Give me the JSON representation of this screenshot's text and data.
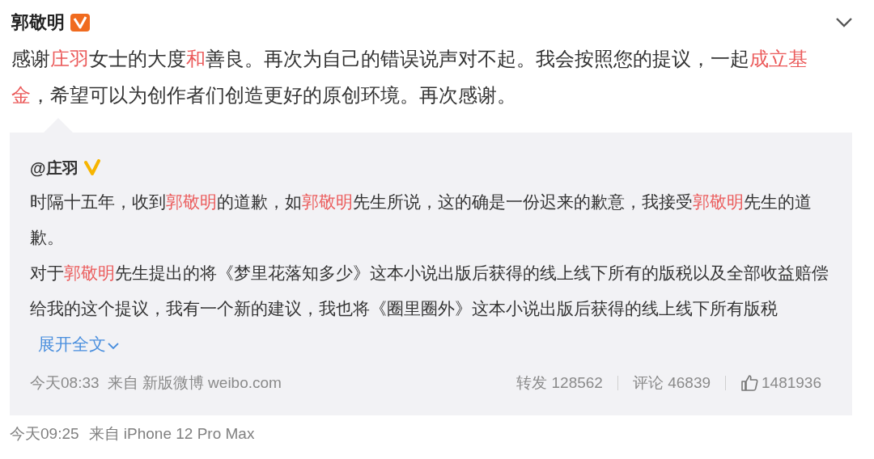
{
  "author": {
    "name": "郭敬明",
    "verified": true
  },
  "post": {
    "segments": [
      {
        "text": "感谢",
        "highlight": false
      },
      {
        "text": "庄羽",
        "highlight": true
      },
      {
        "text": "女士的大度",
        "highlight": false
      },
      {
        "text": "和",
        "highlight": true
      },
      {
        "text": "善良。再次为自己的错误说声对不起。我会按照您的提议，一起",
        "highlight": false
      },
      {
        "text": "成立基金",
        "highlight": true
      },
      {
        "text": "，希望可以为创作者们创造更好的原创环境。再次感谢。",
        "highlight": false
      }
    ]
  },
  "quote": {
    "author": "@庄羽",
    "verified": true,
    "paragraphs": [
      [
        {
          "text": "时隔十五年，收到",
          "highlight": false
        },
        {
          "text": "郭敬明",
          "highlight": true
        },
        {
          "text": "的道歉，如",
          "highlight": false
        },
        {
          "text": "郭敬明",
          "highlight": true
        },
        {
          "text": "先生所说，这的确是一份迟来的歉意，我接受",
          "highlight": false
        },
        {
          "text": "郭敬明",
          "highlight": true
        },
        {
          "text": "先生的道歉。",
          "highlight": false
        }
      ],
      [
        {
          "text": "对于",
          "highlight": false
        },
        {
          "text": "郭敬明",
          "highlight": true
        },
        {
          "text": "先生提出的将《梦里花落知多少》这本小说出版后获得的线上线下所有的版税以及全部收益赔偿给我的这个提议，我有一个新的建议，我也将《圈里圈外》这本小说出版后获得的线上线下所有版税",
          "highlight": false
        }
      ]
    ],
    "expand_link": "展开全文",
    "time": "今天08:33",
    "source": "来自 新版微博 weibo.com",
    "reposts": "转发 128562",
    "comments": "评论 46839",
    "likes": "1481936"
  },
  "footer": {
    "time": "今天09:25",
    "source": "来自 iPhone 12 Pro Max"
  }
}
